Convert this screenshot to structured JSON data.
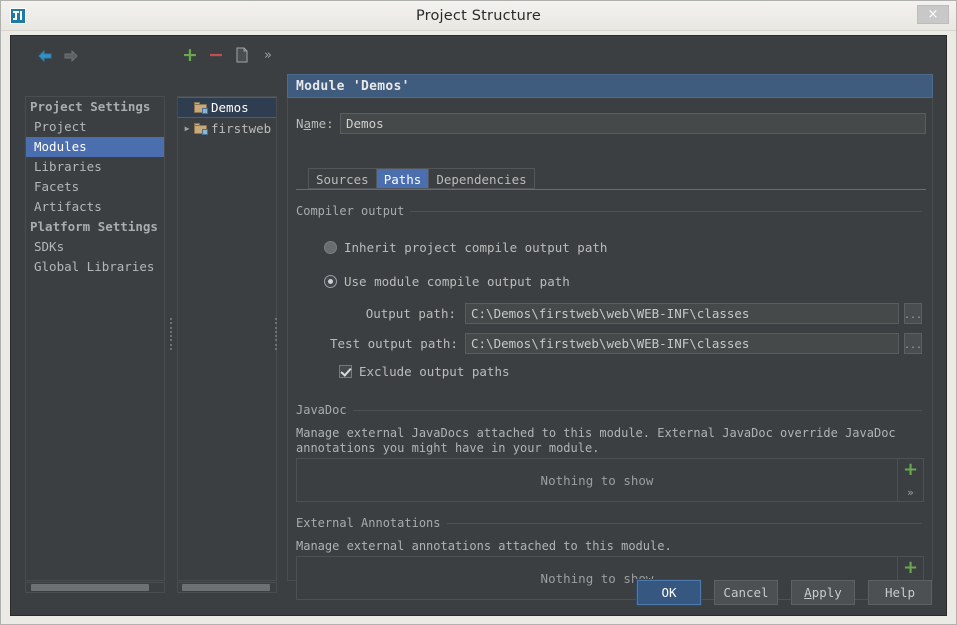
{
  "window": {
    "title": "Project Structure",
    "app_icon": "intellij-idea-icon",
    "close_label": "×"
  },
  "toolbar": {
    "back_icon": "arrow-left-icon",
    "forward_icon": "arrow-right-icon",
    "add_label": "+",
    "remove_label": "−",
    "copy_icon": "copy-icon",
    "more_label": "»"
  },
  "sidebar": {
    "items": [
      {
        "label": "Project Settings",
        "type": "group",
        "selected": false
      },
      {
        "label": "Project",
        "type": "item",
        "selected": false
      },
      {
        "label": "Modules",
        "type": "item",
        "selected": true
      },
      {
        "label": "Libraries",
        "type": "item",
        "selected": false
      },
      {
        "label": "Facets",
        "type": "item",
        "selected": false
      },
      {
        "label": "Artifacts",
        "type": "item",
        "selected": false
      },
      {
        "label": "Platform Settings",
        "type": "group",
        "selected": false
      },
      {
        "label": "SDKs",
        "type": "item",
        "selected": false
      },
      {
        "label": "Global Libraries",
        "type": "item",
        "selected": false
      }
    ]
  },
  "module_tree": {
    "items": [
      {
        "label": "Demos",
        "selected": true,
        "expandable": false,
        "twisty": ""
      },
      {
        "label": "firstweb",
        "selected": false,
        "expandable": true,
        "twisty": "▶"
      }
    ]
  },
  "module": {
    "header": "Module 'Demos'",
    "name_label": "Name:",
    "name_value": "Demos",
    "tabs": [
      {
        "label": "Sources",
        "active": false
      },
      {
        "label": "Paths",
        "active": true
      },
      {
        "label": "Dependencies",
        "active": false
      }
    ]
  },
  "compiler_output": {
    "group_title": "Compiler output",
    "radio_inherit": "Inherit project compile output path",
    "radio_module": "Use module compile output path",
    "radio_selected": "module",
    "output_path_label": "Output path:",
    "output_path_value": "C:\\Demos\\firstweb\\web\\WEB-INF\\classes",
    "test_output_path_label": "Test output path:",
    "test_output_path_value": "C:\\Demos\\firstweb\\web\\WEB-INF\\classes",
    "browse_label": "...",
    "exclude_label": "Exclude output paths",
    "exclude_checked": true
  },
  "javadoc": {
    "group_title": "JavaDoc",
    "description": "Manage external JavaDocs attached to this module. External JavaDoc override JavaDoc annotations you might have in your module.",
    "empty_text": "Nothing to show",
    "add_label": "+",
    "more_label": "»"
  },
  "external_annotations": {
    "group_title": "External Annotations",
    "description": "Manage external annotations attached to this module.",
    "empty_text": "Nothing to show",
    "add_label": "+",
    "more_label": "»"
  },
  "footer": {
    "ok": "OK",
    "cancel": "Cancel",
    "apply_pre": "A",
    "apply_post": "pply",
    "help": "Help"
  },
  "colors": {
    "accent_blue": "#4b6eaf",
    "header_blue": "#3f5b7d",
    "panel_bg": "#3c3f41",
    "add_green": "#6aa84f",
    "remove_red": "#c0504d"
  }
}
